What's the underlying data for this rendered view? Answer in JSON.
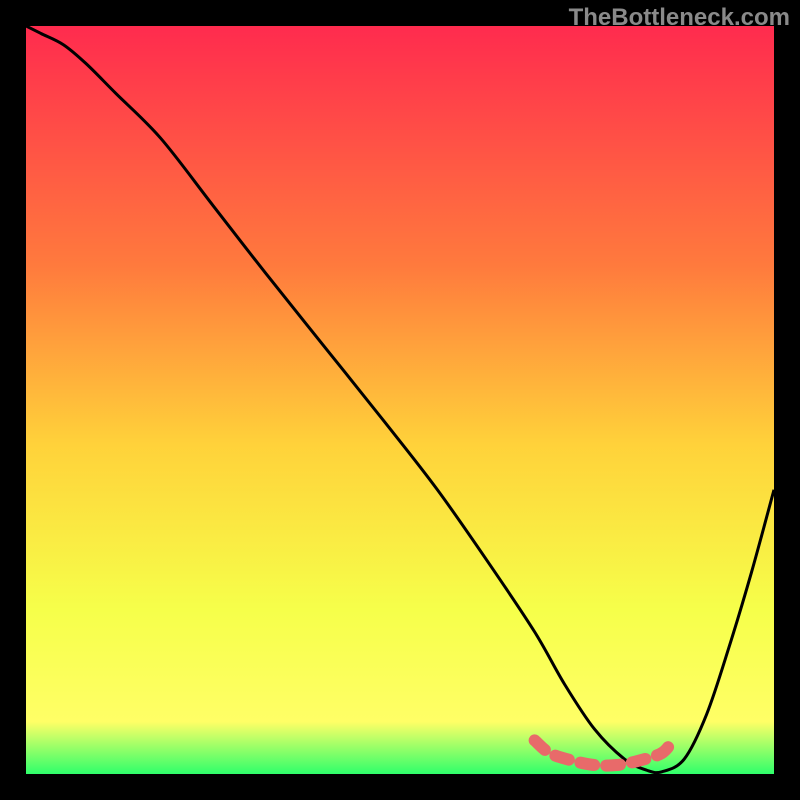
{
  "watermark": "TheBottleneck.com",
  "chart_data": {
    "type": "line",
    "title": "",
    "xlabel": "",
    "ylabel": "",
    "xlim": [
      0,
      100
    ],
    "ylim": [
      0,
      100
    ],
    "gradient_colors": {
      "top": "#ff2b4e",
      "upper_mid": "#ff7a3d",
      "mid": "#ffd23a",
      "lower_mid": "#f6ff4a",
      "lower_yellow": "#ffff66",
      "bottom": "#2fff6b"
    },
    "series": [
      {
        "name": "black-curve",
        "color": "#000000",
        "x": [
          0,
          2,
          5,
          8,
          12,
          18,
          25,
          32,
          40,
          48,
          55,
          62,
          68,
          72,
          76,
          80,
          83,
          85,
          88,
          91,
          94,
          97,
          100
        ],
        "y": [
          100,
          99,
          97.5,
          95,
          91,
          85,
          76,
          67,
          57,
          47,
          38,
          28,
          19,
          12,
          6,
          2,
          0.5,
          0.3,
          2,
          8,
          17,
          27,
          38
        ]
      },
      {
        "name": "pink-zone",
        "color": "#e86a6a",
        "x": [
          68,
          70,
          73,
          76,
          79,
          82,
          85,
          86.5
        ],
        "y": [
          4.5,
          2.8,
          1.8,
          1.2,
          1.2,
          1.8,
          2.8,
          4.5
        ]
      }
    ]
  }
}
